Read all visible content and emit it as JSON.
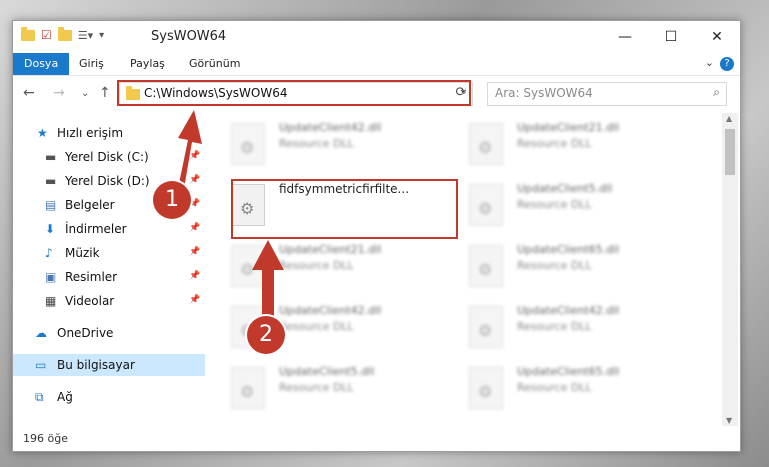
{
  "window": {
    "title": "SysWOW64"
  },
  "ribbon": {
    "tabs": [
      "Dosya",
      "Giriş",
      "Paylaş",
      "Görünüm"
    ]
  },
  "address": {
    "path": "C:\\Windows\\SysWOW64"
  },
  "search": {
    "placeholder": "Ara: SysWOW64"
  },
  "nav": {
    "items": [
      {
        "label": "Hızlı erişim",
        "icon": "star-icon"
      },
      {
        "label": "Yerel Disk (C:)",
        "icon": "drive-icon"
      },
      {
        "label": "Yerel Disk (D:)",
        "icon": "drive-icon"
      },
      {
        "label": "Belgeler",
        "icon": "document-icon"
      },
      {
        "label": "İndirmeler",
        "icon": "download-icon"
      },
      {
        "label": "Müzik",
        "icon": "music-icon"
      },
      {
        "label": "Resimler",
        "icon": "pictures-icon"
      },
      {
        "label": "Videolar",
        "icon": "video-icon"
      },
      {
        "label": "OneDrive",
        "icon": "cloud-icon"
      },
      {
        "label": "Bu bilgisayar",
        "icon": "computer-icon"
      },
      {
        "label": "Ağ",
        "icon": "network-icon"
      }
    ]
  },
  "files": [
    {
      "name": "UpdateClient42.dll",
      "desc": "Resource DLL"
    },
    {
      "name": "UpdateClient21.dll",
      "desc": "Resource DLL"
    },
    {
      "name": "fidfsymmetricfirfilte...",
      "desc": ""
    },
    {
      "name": "UpdateClient5.dll",
      "desc": "Resource DLL"
    },
    {
      "name": "UpdateClient21.dll",
      "desc": "Resource DLL"
    },
    {
      "name": "UpdateClient65.dll",
      "desc": "Resource DLL"
    },
    {
      "name": "UpdateClient42.dll",
      "desc": "Resource DLL"
    },
    {
      "name": "UpdateClient42.dll",
      "desc": "Resource DLL"
    },
    {
      "name": "UpdateClient5.dll",
      "desc": "Resource DLL"
    },
    {
      "name": "UpdateClient65.dll",
      "desc": "Resource DLL"
    }
  ],
  "status": {
    "count": "196 öğe"
  },
  "annotations": {
    "step1": "1",
    "step2": "2"
  },
  "colors": {
    "accent": "#1979ca",
    "highlight": "#c0392b"
  }
}
